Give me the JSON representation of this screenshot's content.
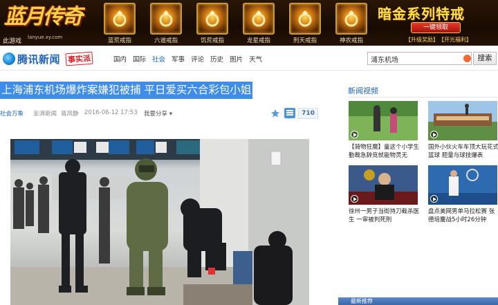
{
  "ad": {
    "logo_text": "蓝月传奇",
    "logo_url": "lanyue.xy.com",
    "corner_text": "此游戏",
    "items": [
      {
        "label": "蓝荒戒指",
        "icon": "ring-icon"
      },
      {
        "label": "六道戒指",
        "icon": "ring-icon"
      },
      {
        "label": "饥荒戒指",
        "icon": "ring-icon"
      },
      {
        "label": "龙星戒指",
        "icon": "ring-icon"
      },
      {
        "label": "刑天戒指",
        "icon": "ring-icon"
      },
      {
        "label": "神农戒指",
        "icon": "ring-icon"
      }
    ],
    "promo_title": "暗金系列特戒",
    "promo_button": "一键领取",
    "links": [
      "【升级奖励】",
      "【开光福利】"
    ]
  },
  "header": {
    "brand_name": "腾讯新闻",
    "brand_badge": "事实派",
    "nav": [
      "国内",
      "国际",
      "社会",
      "军事",
      "评论",
      "历史",
      "图片",
      "天气"
    ],
    "nav_active": "社会",
    "search_value": "浦东机场",
    "search_button": "搜索"
  },
  "article": {
    "headline": "上海浦东机场爆炸案嫌犯被捕 平日爱买六合彩包小姐",
    "category": "社会万象",
    "source": "澎湃新闻",
    "author": "蒋凤静",
    "time": "2016-06-12 17:53",
    "share_label": "我要分享",
    "comment_count": "710"
  },
  "sidebar": {
    "section_title": "新闻视频",
    "videos": [
      {
        "caption": "【骑物狂魔】童这个小学生勤裁急辞竞就能物灵无"
      },
      {
        "caption": "国外小伙火车车顶大玩花式篮球 胆量与球技爆表"
      },
      {
        "caption": "徐州一男子当街持刀截杀医生 一审被判死刑"
      },
      {
        "caption": "盘点美网男单马拉松赛 张德培鏖战5小时26分钟"
      }
    ],
    "bottom_label": "最新推荐"
  },
  "colors": {
    "accent_blue": "#1d62b7",
    "headline_bg": "#3e8dea",
    "ad_gold": "#ffe14a"
  }
}
